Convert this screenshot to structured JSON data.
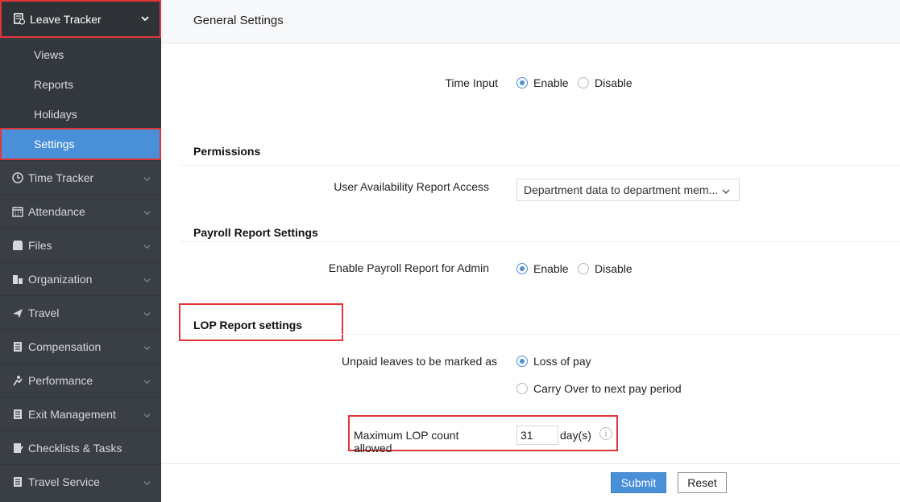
{
  "sidebar": {
    "header": {
      "label": "Leave Tracker",
      "icon": "leave-tracker-icon"
    },
    "subitems": [
      {
        "label": "Views"
      },
      {
        "label": "Reports"
      },
      {
        "label": "Holidays"
      },
      {
        "label": "Settings",
        "active": true
      }
    ],
    "items": [
      {
        "label": "Time Tracker",
        "icon": "clock-icon"
      },
      {
        "label": "Attendance",
        "icon": "calendar-icon"
      },
      {
        "label": "Files",
        "icon": "files-icon"
      },
      {
        "label": "Organization",
        "icon": "organization-icon"
      },
      {
        "label": "Travel",
        "icon": "plane-icon"
      },
      {
        "label": "Compensation",
        "icon": "document-icon"
      },
      {
        "label": "Performance",
        "icon": "performance-icon"
      },
      {
        "label": "Exit Management",
        "icon": "document-icon"
      },
      {
        "label": "Checklists & Tasks",
        "icon": "checklist-icon"
      },
      {
        "label": "Travel Service",
        "icon": "document-icon"
      }
    ]
  },
  "header": {
    "title": "General Settings"
  },
  "general": {
    "time_input": {
      "label": "Time Input",
      "options": [
        "Enable",
        "Disable"
      ],
      "selected": "Enable"
    }
  },
  "permissions": {
    "title": "Permissions",
    "user_availability": {
      "label": "User Availability Report Access",
      "value": "Department data to department mem..."
    }
  },
  "payroll": {
    "title": "Payroll Report Settings",
    "enable_payroll": {
      "label": "Enable Payroll Report for Admin",
      "options": [
        "Enable",
        "Disable"
      ],
      "selected": "Enable"
    }
  },
  "lop": {
    "title": "LOP Report settings",
    "unpaid": {
      "label": "Unpaid leaves to be marked as",
      "options": [
        "Loss of pay",
        "Carry Over to next pay period"
      ],
      "selected": "Loss of pay"
    },
    "max_count": {
      "label": "Maximum LOP count allowed",
      "value": "31",
      "unit": "day(s)",
      "info": "i"
    }
  },
  "footer": {
    "submit": "Submit",
    "reset": "Reset"
  },
  "colors": {
    "accent": "#4a90d9",
    "highlight": "#e0363a",
    "sidebar_bg": "#3a3f45"
  }
}
